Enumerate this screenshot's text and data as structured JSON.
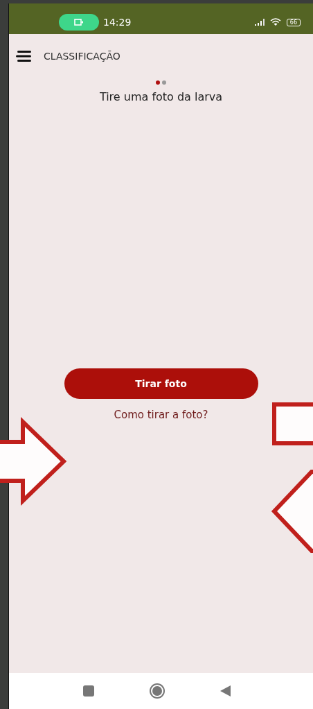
{
  "status_bar": {
    "time": "14:29",
    "battery": "66"
  },
  "header": {
    "title": "CLASSIFICAÇÃO"
  },
  "pager": [
    {
      "selected": true
    },
    {
      "selected": false
    }
  ],
  "instruction": "Tire uma foto da larva",
  "primary_button": "Tirar foto",
  "help_link": "Como tirar a foto?"
}
